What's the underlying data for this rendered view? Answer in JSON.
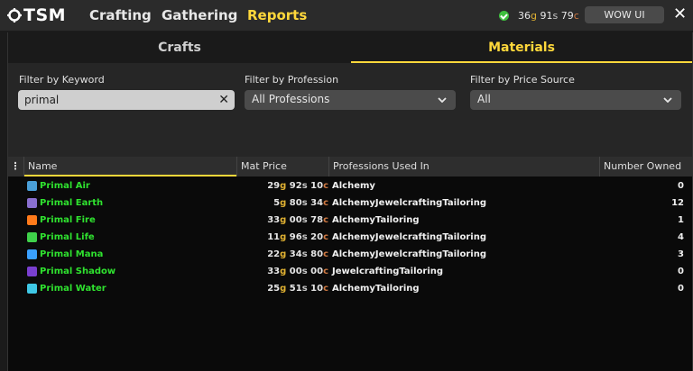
{
  "app": {
    "logo_text": "TSM",
    "nav": [
      {
        "label": "Crafting",
        "active": false
      },
      {
        "label": "Gathering",
        "active": false
      },
      {
        "label": "Reports",
        "active": true
      }
    ],
    "gold": {
      "g": "36",
      "s": "91",
      "c": "79"
    },
    "wowui_label": "WOW UI",
    "close_label": "✕"
  },
  "subtabs": [
    {
      "label": "Crafts",
      "active": false
    },
    {
      "label": "Materials",
      "active": true
    }
  ],
  "filters": {
    "keyword_label": "Filter by Keyword",
    "keyword_value": "primal",
    "profession_label": "Filter by Profession",
    "profession_value": "All Professions",
    "price_source_label": "Filter by Price Source",
    "price_source_value": "All"
  },
  "table": {
    "menu_icon": "⋮",
    "headers": {
      "name": "Name",
      "price": "Mat Price",
      "professions": "Professions Used In",
      "owned": "Number Owned"
    },
    "rows": [
      {
        "name": "Primal Air",
        "icon": "primal-air-icon",
        "color": "#4a9fd8",
        "g": "29",
        "s": "92",
        "c": "10",
        "professions": "Alchemy",
        "owned": "0"
      },
      {
        "name": "Primal Earth",
        "icon": "primal-earth-icon",
        "color": "#8a6fd0",
        "g": "5",
        "s": "80",
        "c": "34",
        "professions": "AlchemyJewelcraftingTailoring",
        "owned": "12"
      },
      {
        "name": "Primal Fire",
        "icon": "primal-fire-icon",
        "color": "#ff7a1a",
        "g": "33",
        "s": "00",
        "c": "78",
        "professions": "AlchemyTailoring",
        "owned": "1"
      },
      {
        "name": "Primal Life",
        "icon": "primal-life-icon",
        "color": "#3fd14a",
        "g": "11",
        "s": "96",
        "c": "20",
        "professions": "AlchemyJewelcraftingTailoring",
        "owned": "4"
      },
      {
        "name": "Primal Mana",
        "icon": "primal-mana-icon",
        "color": "#3aa0ff",
        "g": "22",
        "s": "34",
        "c": "80",
        "professions": "AlchemyJewelcraftingTailoring",
        "owned": "3"
      },
      {
        "name": "Primal Shadow",
        "icon": "primal-shadow-icon",
        "color": "#7a3fd0",
        "g": "33",
        "s": "00",
        "c": "00",
        "professions": "JewelcraftingTailoring",
        "owned": "0"
      },
      {
        "name": "Primal Water",
        "icon": "primal-water-icon",
        "color": "#3fc8e6",
        "g": "25",
        "s": "51",
        "c": "10",
        "professions": "AlchemyTailoring",
        "owned": "0"
      }
    ]
  }
}
